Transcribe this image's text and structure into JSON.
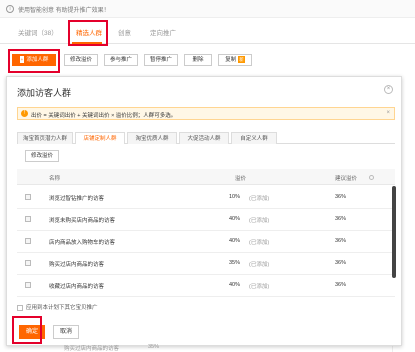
{
  "notice": {
    "text": "使用智能创意 有助提升推广效果！"
  },
  "main_tabs": [
    {
      "label": "关键词（38）"
    },
    {
      "label": "精选人群"
    },
    {
      "label": "创意"
    },
    {
      "label": "定向推广"
    }
  ],
  "toolbar": {
    "add_crowd": "添加人群",
    "edit_bid": "修改溢价",
    "join_promo": "参与推广",
    "pause_promo": "暂停推广",
    "delete": "删除",
    "copy": "复制",
    "copy_badge": "新"
  },
  "modal": {
    "title": "添加访客人群",
    "warning": "出价 = 关键词出价 + 关键词出价 × 溢价比例；人群可多选。",
    "tabs": [
      {
        "label": "淘宝首页潜力人群"
      },
      {
        "label": "店铺定制人群"
      },
      {
        "label": "淘宝优质人群"
      },
      {
        "label": "大促活动人群"
      },
      {
        "label": "自定义人群"
      }
    ],
    "edit_bid_button": "修改溢价",
    "columns": {
      "name": "名称",
      "premium": "溢价",
      "suggested": "建议溢价"
    },
    "rows": [
      {
        "name": "浏览过智钻推广的访客",
        "premium": "10%",
        "status": "(已添加)",
        "suggested": "36%"
      },
      {
        "name": "浏览未购买店内商品的访客",
        "premium": "40%",
        "status": "(已添加)",
        "suggested": "36%"
      },
      {
        "name": "店内商品放入购物车的访客",
        "premium": "40%",
        "status": "(已添加)",
        "suggested": "36%"
      },
      {
        "name": "购买过店内商品的访客",
        "premium": "35%",
        "status": "(已添加)",
        "suggested": "36%"
      },
      {
        "name": "收藏过店内商品的访客",
        "premium": "40%",
        "status": "(已添加)",
        "suggested": "36%"
      }
    ],
    "apply_all": "应用到本计划下其它宝贝推广",
    "ok": "确定",
    "cancel": "取消"
  },
  "bottom_peek": {
    "name": "购买过店内商品的访客",
    "value": "35%"
  },
  "colors": {
    "accent": "#ff6600",
    "highlight": "#e4002b"
  }
}
